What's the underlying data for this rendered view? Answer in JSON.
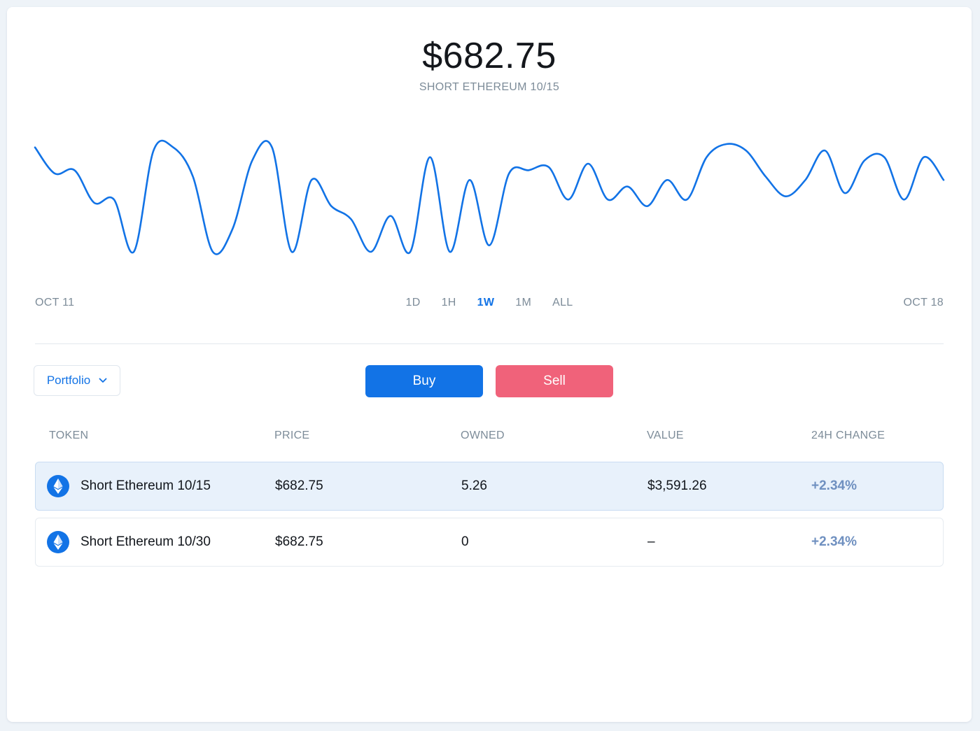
{
  "header": {
    "price": "$682.75",
    "subtitle": "SHORT ETHEREUM 10/15"
  },
  "chart_data": {
    "type": "line",
    "x_start_label": "OCT 11",
    "x_end_label": "OCT 18",
    "color": "#1273e6",
    "values": [
      740,
      700,
      705,
      655,
      660,
      580,
      735,
      740,
      695,
      580,
      615,
      720,
      740,
      580,
      690,
      650,
      630,
      580,
      635,
      580,
      725,
      580,
      690,
      590,
      700,
      705,
      710,
      660,
      715,
      660,
      680,
      650,
      690,
      660,
      725,
      745,
      735,
      695,
      665,
      690,
      735,
      670,
      720,
      725,
      660,
      725,
      690
    ]
  },
  "ranges": {
    "items": [
      {
        "label": "1D"
      },
      {
        "label": "1H"
      },
      {
        "label": "1W"
      },
      {
        "label": "1M"
      },
      {
        "label": "ALL"
      }
    ],
    "active": "1W"
  },
  "controls": {
    "portfolio_label": "Portfolio",
    "buy_label": "Buy",
    "sell_label": "Sell",
    "buy_color": "#1273e6",
    "sell_color": "#f0627a"
  },
  "table": {
    "headers": {
      "token": "TOKEN",
      "price": "PRICE",
      "owned": "OWNED",
      "value": "VALUE",
      "change": "24H CHANGE"
    },
    "rows": [
      {
        "token": "Short Ethereum 10/15",
        "price": "$682.75",
        "owned": "5.26",
        "value": "$3,591.26",
        "change": "+2.34%",
        "selected": true,
        "icon": "ethereum-icon"
      },
      {
        "token": "Short Ethereum 10/30",
        "price": "$682.75",
        "owned": "0",
        "value": "–",
        "change": "+2.34%",
        "selected": false,
        "icon": "ethereum-icon"
      }
    ]
  }
}
